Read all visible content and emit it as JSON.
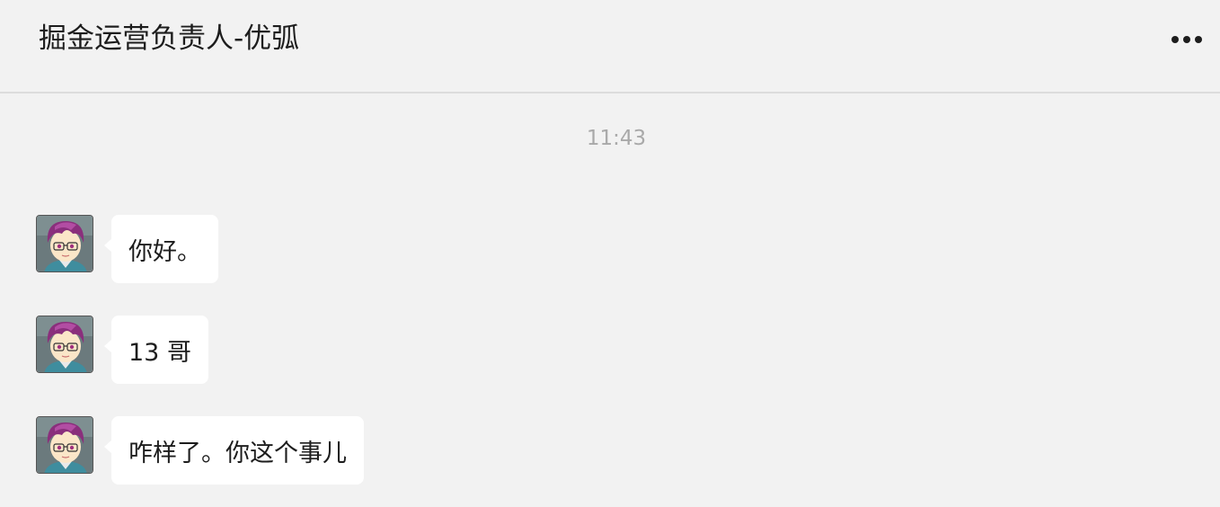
{
  "header": {
    "title": "掘金运营负责人-优弧",
    "more_icon": "more-horizontal-icon"
  },
  "chat": {
    "timestamp": "11:43",
    "messages": [
      {
        "sender": "incoming",
        "avatar_icon": "cartoon-avatar",
        "text": "你好。"
      },
      {
        "sender": "incoming",
        "avatar_icon": "cartoon-avatar",
        "text": "13 哥"
      },
      {
        "sender": "incoming",
        "avatar_icon": "cartoon-avatar",
        "text": "咋样了。你这个事儿"
      }
    ]
  },
  "colors": {
    "background": "#f2f2f2",
    "bubble": "#ffffff",
    "text": "#1d1d1d",
    "timestamp": "#a9a9a9",
    "divider": "#dcdcdc"
  }
}
